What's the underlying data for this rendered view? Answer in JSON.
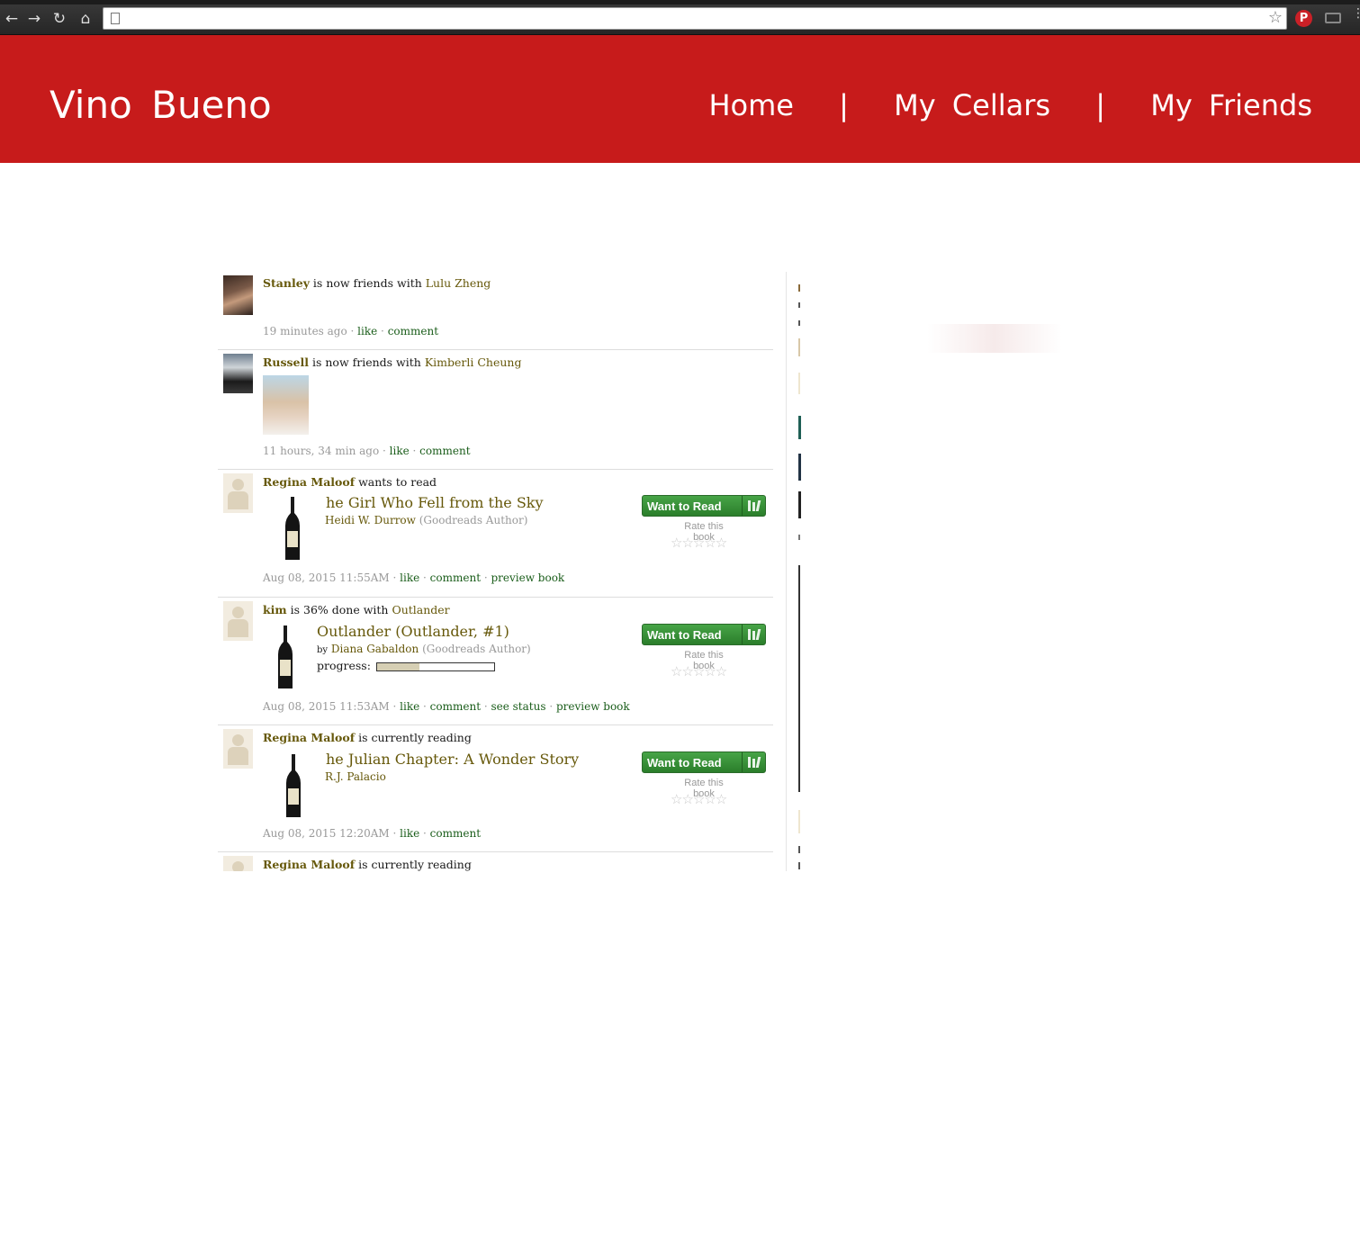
{
  "browser": {
    "url": "",
    "icons": [
      "back-icon",
      "forward-icon",
      "reload-icon",
      "home-icon",
      "page-icon",
      "bookmark-star-icon",
      "pinterest-icon",
      "cast-icon",
      "menu-icon"
    ]
  },
  "header": {
    "brand": "Vino  Bueno",
    "nav": [
      "Home",
      "My  Cellars",
      "My  Friends"
    ],
    "separator": "|",
    "bg_color": "#c71b1b"
  },
  "feed": [
    {
      "user": "Stanley",
      "action": " is now friends with ",
      "target": "Lulu Zheng",
      "time": "19 minutes ago",
      "links": [
        "like",
        "comment"
      ]
    },
    {
      "user": "Russell",
      "action": " is now friends with ",
      "target": "Kimberli Cheung",
      "time": "11 hours, 34 min ago",
      "links": [
        "like",
        "comment"
      ]
    },
    {
      "user": "Regina Maloof",
      "action": " wants to read",
      "book_title": "he Girl Who Fell from the Sky",
      "by_prefix": "",
      "author": "Heidi W. Durrow",
      "author_role": "(Goodreads Author)",
      "time": "Aug 08, 2015 11:55AM",
      "links": [
        "like",
        "comment",
        "preview book"
      ]
    },
    {
      "user": "kim",
      "action": " is 36% done with ",
      "target": "Outlander",
      "book_title": "Outlander (Outlander, #1)",
      "by_prefix": "by",
      "author": "Diana Gabaldon",
      "author_role": "(Goodreads Author)",
      "progress_label": "progress:",
      "progress": 0.36,
      "time": "Aug 08, 2015 11:53AM",
      "links": [
        "like",
        "comment",
        "see status",
        "preview book"
      ]
    },
    {
      "user": "Regina Maloof",
      "action": " is currently reading",
      "book_title": "he Julian Chapter: A Wonder Story",
      "by_prefix": "",
      "author": "R.J. Palacio",
      "time": "Aug 08, 2015 12:20AM",
      "links": [
        "like",
        "comment"
      ]
    },
    {
      "user": "Regina Maloof",
      "action": " is currently reading"
    }
  ],
  "actions": {
    "want_to_read": "Want to Read",
    "rate_label": "Rate this book",
    "stars": "☆☆☆☆☆"
  },
  "separator_dot": " · "
}
